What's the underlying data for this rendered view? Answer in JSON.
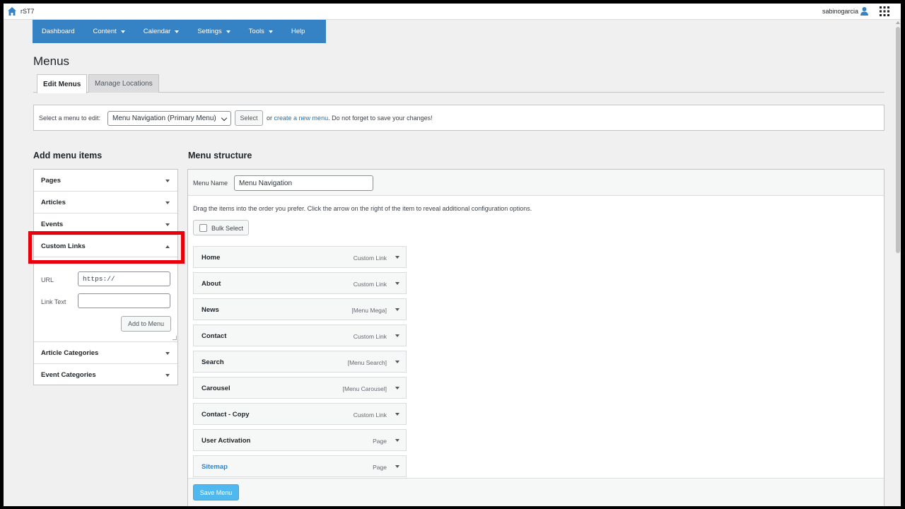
{
  "topbar": {
    "site_name": "rST7",
    "user_name": "sabinogarcia",
    "home_icon": "home-icon",
    "user_icon": "user-icon",
    "apps_icon": "apps-grid-icon"
  },
  "nav": {
    "items": [
      {
        "label": "Dashboard",
        "has_dropdown": false
      },
      {
        "label": "Content",
        "has_dropdown": true
      },
      {
        "label": "Calendar",
        "has_dropdown": true
      },
      {
        "label": "Settings",
        "has_dropdown": true
      },
      {
        "label": "Tools",
        "has_dropdown": true
      },
      {
        "label": "Help",
        "has_dropdown": false
      }
    ]
  },
  "page": {
    "title": "Menus",
    "tabs": [
      {
        "label": "Edit Menus",
        "active": true
      },
      {
        "label": "Manage Locations",
        "active": false
      }
    ]
  },
  "select_bar": {
    "label": "Select a menu to edit:",
    "selected_menu": "Menu Navigation (Primary Menu)",
    "select_button": "Select",
    "or_text": "or",
    "create_link": "create a new menu",
    "reminder": ". Do not forget to save your changes!"
  },
  "add_items": {
    "heading": "Add menu items",
    "sections": [
      "Pages",
      "Articles",
      "Events",
      "Custom Links",
      "Article Categories",
      "Event Categories"
    ],
    "expanded": "Custom Links",
    "custom_links": {
      "url_label": "URL",
      "url_value": "https://",
      "link_text_label": "Link Text",
      "link_text_value": "",
      "add_button": "Add to Menu"
    }
  },
  "structure": {
    "heading": "Menu structure",
    "menu_name_label": "Menu Name",
    "menu_name_value": "Menu Navigation",
    "instructions": "Drag the items into the order you prefer. Click the arrow on the right of the item to reveal additional configuration options.",
    "bulk_select_label": "Bulk Select",
    "items": [
      {
        "name": "Home",
        "type": "Custom Link"
      },
      {
        "name": "About",
        "type": "Custom Link"
      },
      {
        "name": "News",
        "type": "[Menu Mega]"
      },
      {
        "name": "Contact",
        "type": "Custom Link"
      },
      {
        "name": "Search",
        "type": "[Menu Search]"
      },
      {
        "name": "Carousel",
        "type": "[Menu Carousel]"
      },
      {
        "name": "Contact - Copy",
        "type": "Custom Link"
      },
      {
        "name": "User Activation",
        "type": "Page"
      },
      {
        "name": "Sitemap",
        "type": "Page"
      }
    ],
    "save_button": "Save Menu"
  },
  "colors": {
    "nav_bg": "#3582c4",
    "highlight": "#e8000b",
    "save_button": "#4fb8ee",
    "link": "#2271b1"
  }
}
